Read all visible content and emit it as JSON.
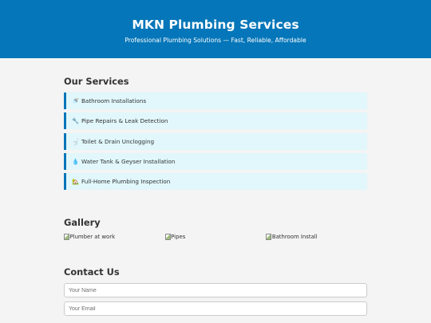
{
  "header": {
    "title": "MKN Plumbing Services",
    "tagline": "Professional Plumbing Solutions — Fast, Reliable, Affordable"
  },
  "services": {
    "heading": "Our Services",
    "items": [
      {
        "icon": "🚿",
        "label": "Bathroom Installations"
      },
      {
        "icon": "🔧",
        "label": "Pipe Repairs & Leak Detection"
      },
      {
        "icon": "🚽",
        "label": "Toilet & Drain Unclogging"
      },
      {
        "icon": "💧",
        "label": "Water Tank & Geyser Installation"
      },
      {
        "icon": "🏡",
        "label": "Full-Home Plumbing Inspection"
      }
    ]
  },
  "gallery": {
    "heading": "Gallery",
    "images": [
      {
        "alt": "Plumber at work"
      },
      {
        "alt": "Pipes"
      },
      {
        "alt": "Bathroom Install"
      }
    ]
  },
  "contact": {
    "heading": "Contact Us",
    "name_placeholder": "Your Name",
    "email_placeholder": "Your Email"
  },
  "colors": {
    "header_bg": "#0576b9",
    "service_bg": "#e1f7fc",
    "page_bg": "#f4f4f4"
  }
}
